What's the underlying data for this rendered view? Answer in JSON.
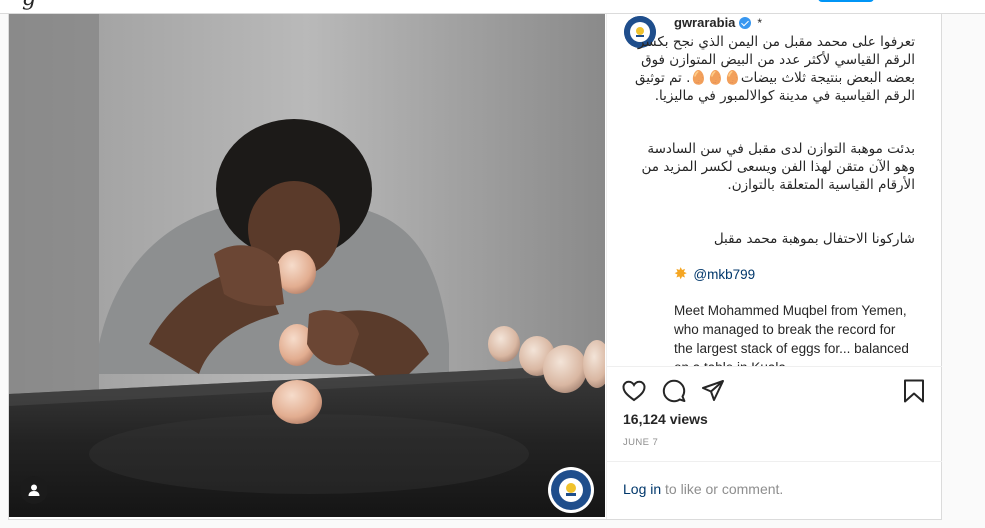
{
  "header": {
    "logo_fragment": "g"
  },
  "post": {
    "username": "gwrarabia",
    "dot": "*",
    "caption_ar_1": "تعرفوا على محمد مقبل من اليمن الذي نجح بكسر الرقم القياسي لأكثر عدد من البيض المتوازن فوق بعضه البعض بنتيجة ثلاث بيضات🥚🥚🥚. تم توثيق الرقم القياسية في مدينة كوالالمبور في ماليزيا.",
    "caption_ar_2": "بدئت موهبة التوازن لدى مقبل في سن السادسة وهو الآن متقن لهذا الفن ويسعى لكسر المزيد من الأرقام القياسية المتعلقة بالتوازن.",
    "caption_ar_3": "شاركونا الاحتفال بموهبة محمد مقبل",
    "mention": "@mkb799",
    "caption_en": "Meet Mohammed Muqbel from Yemen, who managed to break the record for the largest stack of eggs for... balanced on a table in Kuala...",
    "views": "16,124 views",
    "date": "JUNE 7",
    "login_link": "Log in",
    "login_rest": " to like or comment."
  },
  "icons": {
    "like": "heart-icon",
    "comment": "comment-icon",
    "share": "paper-plane-icon",
    "save": "bookmark-icon",
    "user_tag": "user-tag-icon",
    "verified": "verified-badge-icon",
    "mention_emoji": "burst-icon"
  },
  "colors": {
    "link": "#00376b",
    "verified": "#3897f0",
    "follow": "#0095f6"
  }
}
